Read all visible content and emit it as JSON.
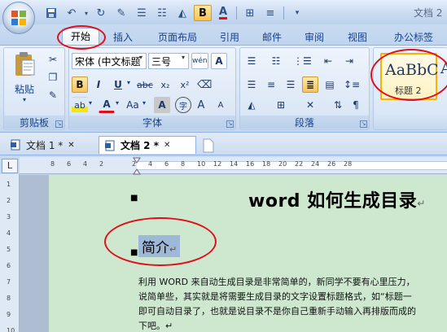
{
  "titlebar": {
    "title": "文档 2"
  },
  "qat": {
    "bold": "B",
    "font_color": "A"
  },
  "tabs": [
    "开始",
    "插入",
    "页面布局",
    "引用",
    "邮件",
    "审阅",
    "视图",
    "办公标签"
  ],
  "clipboard": {
    "paste": "粘贴",
    "label": "剪贴板"
  },
  "font": {
    "name": "宋体 (中文标题",
    "size": "三号",
    "wen": "wén",
    "A_btn": "A",
    "bold": "B",
    "italic": "I",
    "underline": "U",
    "strike": "abc",
    "sub": "x₂",
    "sup": "x²",
    "highlight": "ab",
    "color": "A",
    "case": "Aa",
    "shade": "A",
    "circle": "字",
    "grow": "A",
    "shrink": "A",
    "label": "字体"
  },
  "paragraph": {
    "label": "段落"
  },
  "styles": {
    "preview": "AaBbC",
    "name": "标题 2",
    "preview2": "A"
  },
  "doctabs": [
    {
      "label": "文档 1 *",
      "close": "✕"
    },
    {
      "label": "文档 2 *",
      "close": "✕"
    }
  ],
  "ruler": {
    "ticks": [
      "8",
      "6",
      "4",
      "2",
      "",
      "2",
      "4",
      "6",
      "8",
      "10",
      "12",
      "14",
      "16",
      "18",
      "20",
      "22",
      "24",
      "26",
      "28"
    ],
    "vticks": [
      "1",
      "2",
      "3",
      "4",
      "5",
      "6",
      "7",
      "8",
      "9",
      "10"
    ]
  },
  "document": {
    "title": "word 如何生成目录",
    "pilcrow": "↵",
    "heading": "简介",
    "lines": [
      "利用 WORD 来自动生成目录是非常简单的，新同学不要有心里压力，",
      "说简单些，其实就是将需要生成目录的文字设置标题格式，如“标题一",
      "即可自动目录了，也就是说目录不是你自己重新手动输入再排版而成的",
      "下吧。↵"
    ]
  },
  "colors": {
    "annotation": "#e0101a",
    "page": "#cde8cf"
  }
}
